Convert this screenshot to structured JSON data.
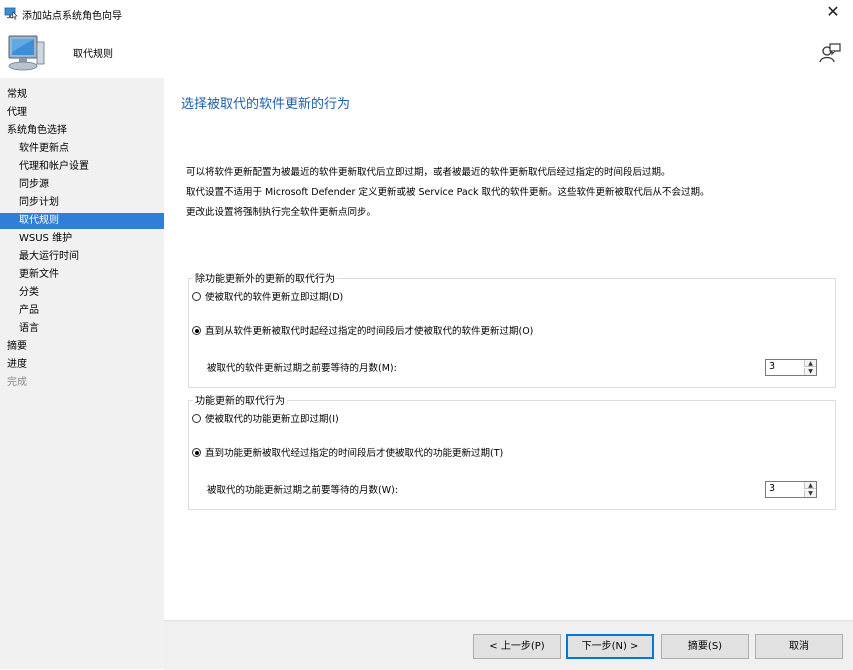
{
  "window": {
    "title": "添加站点系统角色向导",
    "close_glyph": "✕"
  },
  "banner": {
    "title": "取代规则"
  },
  "nav": {
    "items": [
      {
        "label": "常规",
        "level": 1,
        "state": "normal"
      },
      {
        "label": "代理",
        "level": 1,
        "state": "normal"
      },
      {
        "label": "系统角色选择",
        "level": 1,
        "state": "normal"
      },
      {
        "label": "软件更新点",
        "level": 2,
        "state": "normal"
      },
      {
        "label": "代理和帐户设置",
        "level": 2,
        "state": "normal"
      },
      {
        "label": "同步源",
        "level": 2,
        "state": "normal"
      },
      {
        "label": "同步计划",
        "level": 2,
        "state": "normal"
      },
      {
        "label": "取代规则",
        "level": 2,
        "state": "active"
      },
      {
        "label": "WSUS 维护",
        "level": 2,
        "state": "normal"
      },
      {
        "label": "最大运行时间",
        "level": 2,
        "state": "normal"
      },
      {
        "label": "更新文件",
        "level": 2,
        "state": "normal"
      },
      {
        "label": "分类",
        "level": 2,
        "state": "normal"
      },
      {
        "label": "产品",
        "level": 2,
        "state": "normal"
      },
      {
        "label": "语言",
        "level": 2,
        "state": "normal"
      },
      {
        "label": "摘要",
        "level": 1,
        "state": "normal"
      },
      {
        "label": "进度",
        "level": 1,
        "state": "normal"
      },
      {
        "label": "完成",
        "level": 1,
        "state": "disabled"
      }
    ]
  },
  "main": {
    "heading": "选择被取代的软件更新的行为",
    "desc1": "可以将软件更新配置为被最近的软件更新取代后立即过期，或者被最近的软件更新取代后经过指定的时间段后过期。",
    "desc2": "取代设置不适用于 Microsoft Defender 定义更新或被 Service Pack 取代的软件更新。这些软件更新被取代后从不会过期。",
    "desc3": "更改此设置将强制执行完全软件更新点同步。",
    "group1": {
      "title": "除功能更新外的更新的取代行为",
      "option_immediate": "使被取代的软件更新立即过期(D)",
      "option_delay": "直到从软件更新被取代时起经过指定的时间段后才使被取代的软件更新过期(O)",
      "selected": "delay",
      "month_label": "被取代的软件更新过期之前要等待的月数(M):",
      "months": "3"
    },
    "group2": {
      "title": "功能更新的取代行为",
      "option_immediate": "使被取代的功能更新立即过期(I)",
      "option_delay": "直到功能更新被取代经过指定的时间段后才使被取代的功能更新过期(T)",
      "selected": "delay",
      "month_label": "被取代的功能更新过期之前要等待的月数(W):",
      "months": "3"
    }
  },
  "footer": {
    "prev": "< 上一步(P)",
    "next": "下一步(N) >",
    "summary": "摘要(S)",
    "cancel": "取消"
  },
  "colors": {
    "accent": "#2f7ed8",
    "heading": "#1f5fa8",
    "nav_bg": "#f1f1f1"
  }
}
